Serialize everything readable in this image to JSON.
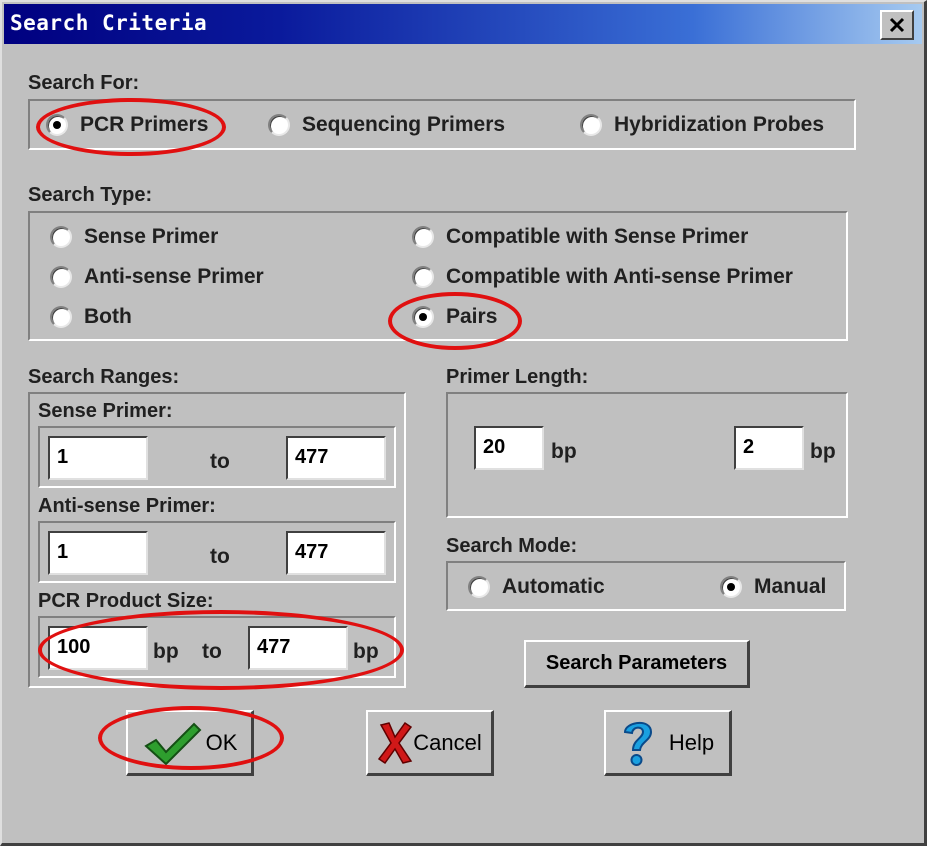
{
  "window": {
    "title": "Search Criteria"
  },
  "search_for": {
    "label": "Search For:",
    "options": [
      "PCR Primers",
      "Sequencing Primers",
      "Hybridization Probes"
    ],
    "selected": "PCR Primers"
  },
  "search_type": {
    "label": "Search Type:",
    "options": [
      "Sense Primer",
      "Anti-sense Primer",
      "Both",
      "Compatible with Sense Primer",
      "Compatible with Anti-sense Primer",
      "Pairs"
    ],
    "selected": "Pairs"
  },
  "search_ranges": {
    "label": "Search Ranges:",
    "sense": {
      "label": "Sense Primer:",
      "from": "1",
      "to_label": "to",
      "to": "477"
    },
    "antisense": {
      "label": "Anti-sense Primer:",
      "from": "1",
      "to_label": "to",
      "to": "477"
    },
    "product": {
      "label": "PCR Product Size:",
      "from": "100",
      "from_unit": "bp",
      "to_label": "to",
      "to": "477",
      "to_unit": "bp"
    }
  },
  "primer_length": {
    "label": "Primer Length:",
    "length": "20",
    "length_unit": "bp",
    "tolerance": "2",
    "tolerance_unit": "bp"
  },
  "search_mode": {
    "label": "Search Mode:",
    "options": [
      "Automatic",
      "Manual"
    ],
    "selected": "Manual"
  },
  "buttons": {
    "search_parameters": "Search Parameters",
    "ok": "OK",
    "cancel": "Cancel",
    "help": "Help"
  },
  "icons": {
    "close": "close-icon",
    "ok": "check-icon",
    "cancel": "x-icon",
    "help": "question-icon"
  },
  "colors": {
    "title_bar": "#000080",
    "dialog_bg": "#c0c0c0",
    "highlight": "#e01010",
    "check": "#2e9e2e",
    "cancel_x": "#d01818",
    "help_q": "#1aa0e0"
  }
}
